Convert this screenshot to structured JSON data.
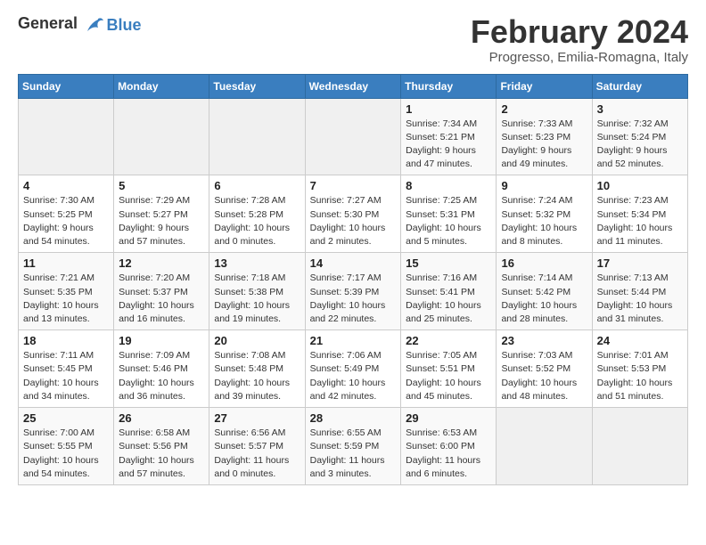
{
  "logo": {
    "text_general": "General",
    "text_blue": "Blue"
  },
  "header": {
    "title": "February 2024",
    "subtitle": "Progresso, Emilia-Romagna, Italy"
  },
  "weekdays": [
    "Sunday",
    "Monday",
    "Tuesday",
    "Wednesday",
    "Thursday",
    "Friday",
    "Saturday"
  ],
  "weeks": [
    [
      {
        "day": "",
        "info": ""
      },
      {
        "day": "",
        "info": ""
      },
      {
        "day": "",
        "info": ""
      },
      {
        "day": "",
        "info": ""
      },
      {
        "day": "1",
        "info": "Sunrise: 7:34 AM\nSunset: 5:21 PM\nDaylight: 9 hours\nand 47 minutes."
      },
      {
        "day": "2",
        "info": "Sunrise: 7:33 AM\nSunset: 5:23 PM\nDaylight: 9 hours\nand 49 minutes."
      },
      {
        "day": "3",
        "info": "Sunrise: 7:32 AM\nSunset: 5:24 PM\nDaylight: 9 hours\nand 52 minutes."
      }
    ],
    [
      {
        "day": "4",
        "info": "Sunrise: 7:30 AM\nSunset: 5:25 PM\nDaylight: 9 hours\nand 54 minutes."
      },
      {
        "day": "5",
        "info": "Sunrise: 7:29 AM\nSunset: 5:27 PM\nDaylight: 9 hours\nand 57 minutes."
      },
      {
        "day": "6",
        "info": "Sunrise: 7:28 AM\nSunset: 5:28 PM\nDaylight: 10 hours\nand 0 minutes."
      },
      {
        "day": "7",
        "info": "Sunrise: 7:27 AM\nSunset: 5:30 PM\nDaylight: 10 hours\nand 2 minutes."
      },
      {
        "day": "8",
        "info": "Sunrise: 7:25 AM\nSunset: 5:31 PM\nDaylight: 10 hours\nand 5 minutes."
      },
      {
        "day": "9",
        "info": "Sunrise: 7:24 AM\nSunset: 5:32 PM\nDaylight: 10 hours\nand 8 minutes."
      },
      {
        "day": "10",
        "info": "Sunrise: 7:23 AM\nSunset: 5:34 PM\nDaylight: 10 hours\nand 11 minutes."
      }
    ],
    [
      {
        "day": "11",
        "info": "Sunrise: 7:21 AM\nSunset: 5:35 PM\nDaylight: 10 hours\nand 13 minutes."
      },
      {
        "day": "12",
        "info": "Sunrise: 7:20 AM\nSunset: 5:37 PM\nDaylight: 10 hours\nand 16 minutes."
      },
      {
        "day": "13",
        "info": "Sunrise: 7:18 AM\nSunset: 5:38 PM\nDaylight: 10 hours\nand 19 minutes."
      },
      {
        "day": "14",
        "info": "Sunrise: 7:17 AM\nSunset: 5:39 PM\nDaylight: 10 hours\nand 22 minutes."
      },
      {
        "day": "15",
        "info": "Sunrise: 7:16 AM\nSunset: 5:41 PM\nDaylight: 10 hours\nand 25 minutes."
      },
      {
        "day": "16",
        "info": "Sunrise: 7:14 AM\nSunset: 5:42 PM\nDaylight: 10 hours\nand 28 minutes."
      },
      {
        "day": "17",
        "info": "Sunrise: 7:13 AM\nSunset: 5:44 PM\nDaylight: 10 hours\nand 31 minutes."
      }
    ],
    [
      {
        "day": "18",
        "info": "Sunrise: 7:11 AM\nSunset: 5:45 PM\nDaylight: 10 hours\nand 34 minutes."
      },
      {
        "day": "19",
        "info": "Sunrise: 7:09 AM\nSunset: 5:46 PM\nDaylight: 10 hours\nand 36 minutes."
      },
      {
        "day": "20",
        "info": "Sunrise: 7:08 AM\nSunset: 5:48 PM\nDaylight: 10 hours\nand 39 minutes."
      },
      {
        "day": "21",
        "info": "Sunrise: 7:06 AM\nSunset: 5:49 PM\nDaylight: 10 hours\nand 42 minutes."
      },
      {
        "day": "22",
        "info": "Sunrise: 7:05 AM\nSunset: 5:51 PM\nDaylight: 10 hours\nand 45 minutes."
      },
      {
        "day": "23",
        "info": "Sunrise: 7:03 AM\nSunset: 5:52 PM\nDaylight: 10 hours\nand 48 minutes."
      },
      {
        "day": "24",
        "info": "Sunrise: 7:01 AM\nSunset: 5:53 PM\nDaylight: 10 hours\nand 51 minutes."
      }
    ],
    [
      {
        "day": "25",
        "info": "Sunrise: 7:00 AM\nSunset: 5:55 PM\nDaylight: 10 hours\nand 54 minutes."
      },
      {
        "day": "26",
        "info": "Sunrise: 6:58 AM\nSunset: 5:56 PM\nDaylight: 10 hours\nand 57 minutes."
      },
      {
        "day": "27",
        "info": "Sunrise: 6:56 AM\nSunset: 5:57 PM\nDaylight: 11 hours\nand 0 minutes."
      },
      {
        "day": "28",
        "info": "Sunrise: 6:55 AM\nSunset: 5:59 PM\nDaylight: 11 hours\nand 3 minutes."
      },
      {
        "day": "29",
        "info": "Sunrise: 6:53 AM\nSunset: 6:00 PM\nDaylight: 11 hours\nand 6 minutes."
      },
      {
        "day": "",
        "info": ""
      },
      {
        "day": "",
        "info": ""
      }
    ]
  ]
}
